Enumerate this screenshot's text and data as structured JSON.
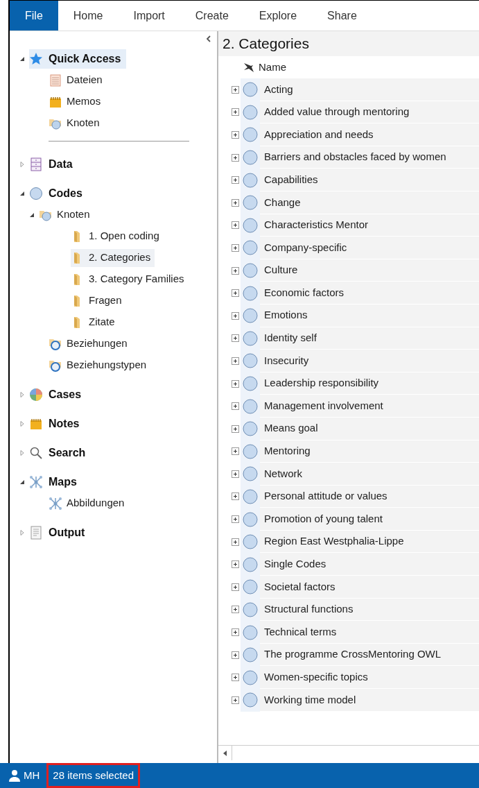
{
  "menu": [
    {
      "label": "File",
      "selected": true
    },
    {
      "label": "Home",
      "selected": false
    },
    {
      "label": "Import",
      "selected": false
    },
    {
      "label": "Create",
      "selected": false
    },
    {
      "label": "Explore",
      "selected": false
    },
    {
      "label": "Share",
      "selected": false
    }
  ],
  "sidebar": {
    "groups": [
      {
        "label": "Quick Access",
        "kind": "star",
        "expanded": true,
        "selected": true,
        "children": [
          {
            "label": "Dateien",
            "kind": "files",
            "selected": false
          },
          {
            "label": "Memos",
            "kind": "memo",
            "selected": false
          },
          {
            "label": "Knoten",
            "kind": "nodes",
            "selected": false
          }
        ]
      },
      {
        "label": "Data",
        "kind": "data",
        "expanded": false,
        "selected": false
      },
      {
        "label": "Codes",
        "kind": "code",
        "expanded": true,
        "selected": false,
        "children": [
          {
            "label": "Knoten",
            "kind": "nodes",
            "expanded": true,
            "selected": false,
            "children": [
              {
                "label": "1. Open coding",
                "kind": "folder",
                "selected": false
              },
              {
                "label": "2. Categories",
                "kind": "folder",
                "selected": true
              },
              {
                "label": "3. Category Families",
                "kind": "folder",
                "selected": false
              },
              {
                "label": "Fragen",
                "kind": "folder",
                "selected": false
              },
              {
                "label": "Zitate",
                "kind": "folder",
                "selected": false
              }
            ]
          },
          {
            "label": "Beziehungen",
            "kind": "relations",
            "selected": false
          },
          {
            "label": "Beziehungstypen",
            "kind": "relations",
            "selected": false
          }
        ]
      },
      {
        "label": "Cases",
        "kind": "cases",
        "expanded": false,
        "selected": false
      },
      {
        "label": "Notes",
        "kind": "memo",
        "expanded": false,
        "selected": false
      },
      {
        "label": "Search",
        "kind": "search",
        "expanded": false,
        "selected": false
      },
      {
        "label": "Maps",
        "kind": "maps",
        "expanded": true,
        "selected": false,
        "children": [
          {
            "label": "Abbildungen",
            "kind": "maps",
            "selected": false
          }
        ]
      },
      {
        "label": "Output",
        "kind": "output",
        "expanded": false,
        "selected": false
      }
    ]
  },
  "content": {
    "title": "2. Categories",
    "column": "Name",
    "rows": [
      "Acting",
      "Added value through mentoring",
      "Appreciation and needs",
      "Barriers and obstacles faced by women",
      "Capabilities",
      "Change",
      "Characteristics Mentor",
      "Company-specific",
      "Culture",
      "Economic factors",
      "Emotions",
      "Identity self",
      "Insecurity",
      "Leadership responsibility",
      "Management involvement",
      "Means goal",
      "Mentoring",
      "Network",
      "Personal attitude or values",
      "Promotion of young talent",
      "Region East Westphalia-Lippe",
      "Single Codes",
      "Societal factors",
      "Structural functions",
      "Technical terms",
      "The programme CrossMentoring OWL",
      "Women-specific topics",
      "Working time model"
    ]
  },
  "status_bar": {
    "user": "MH",
    "selection": "28 items selected",
    "highlighted": true
  }
}
